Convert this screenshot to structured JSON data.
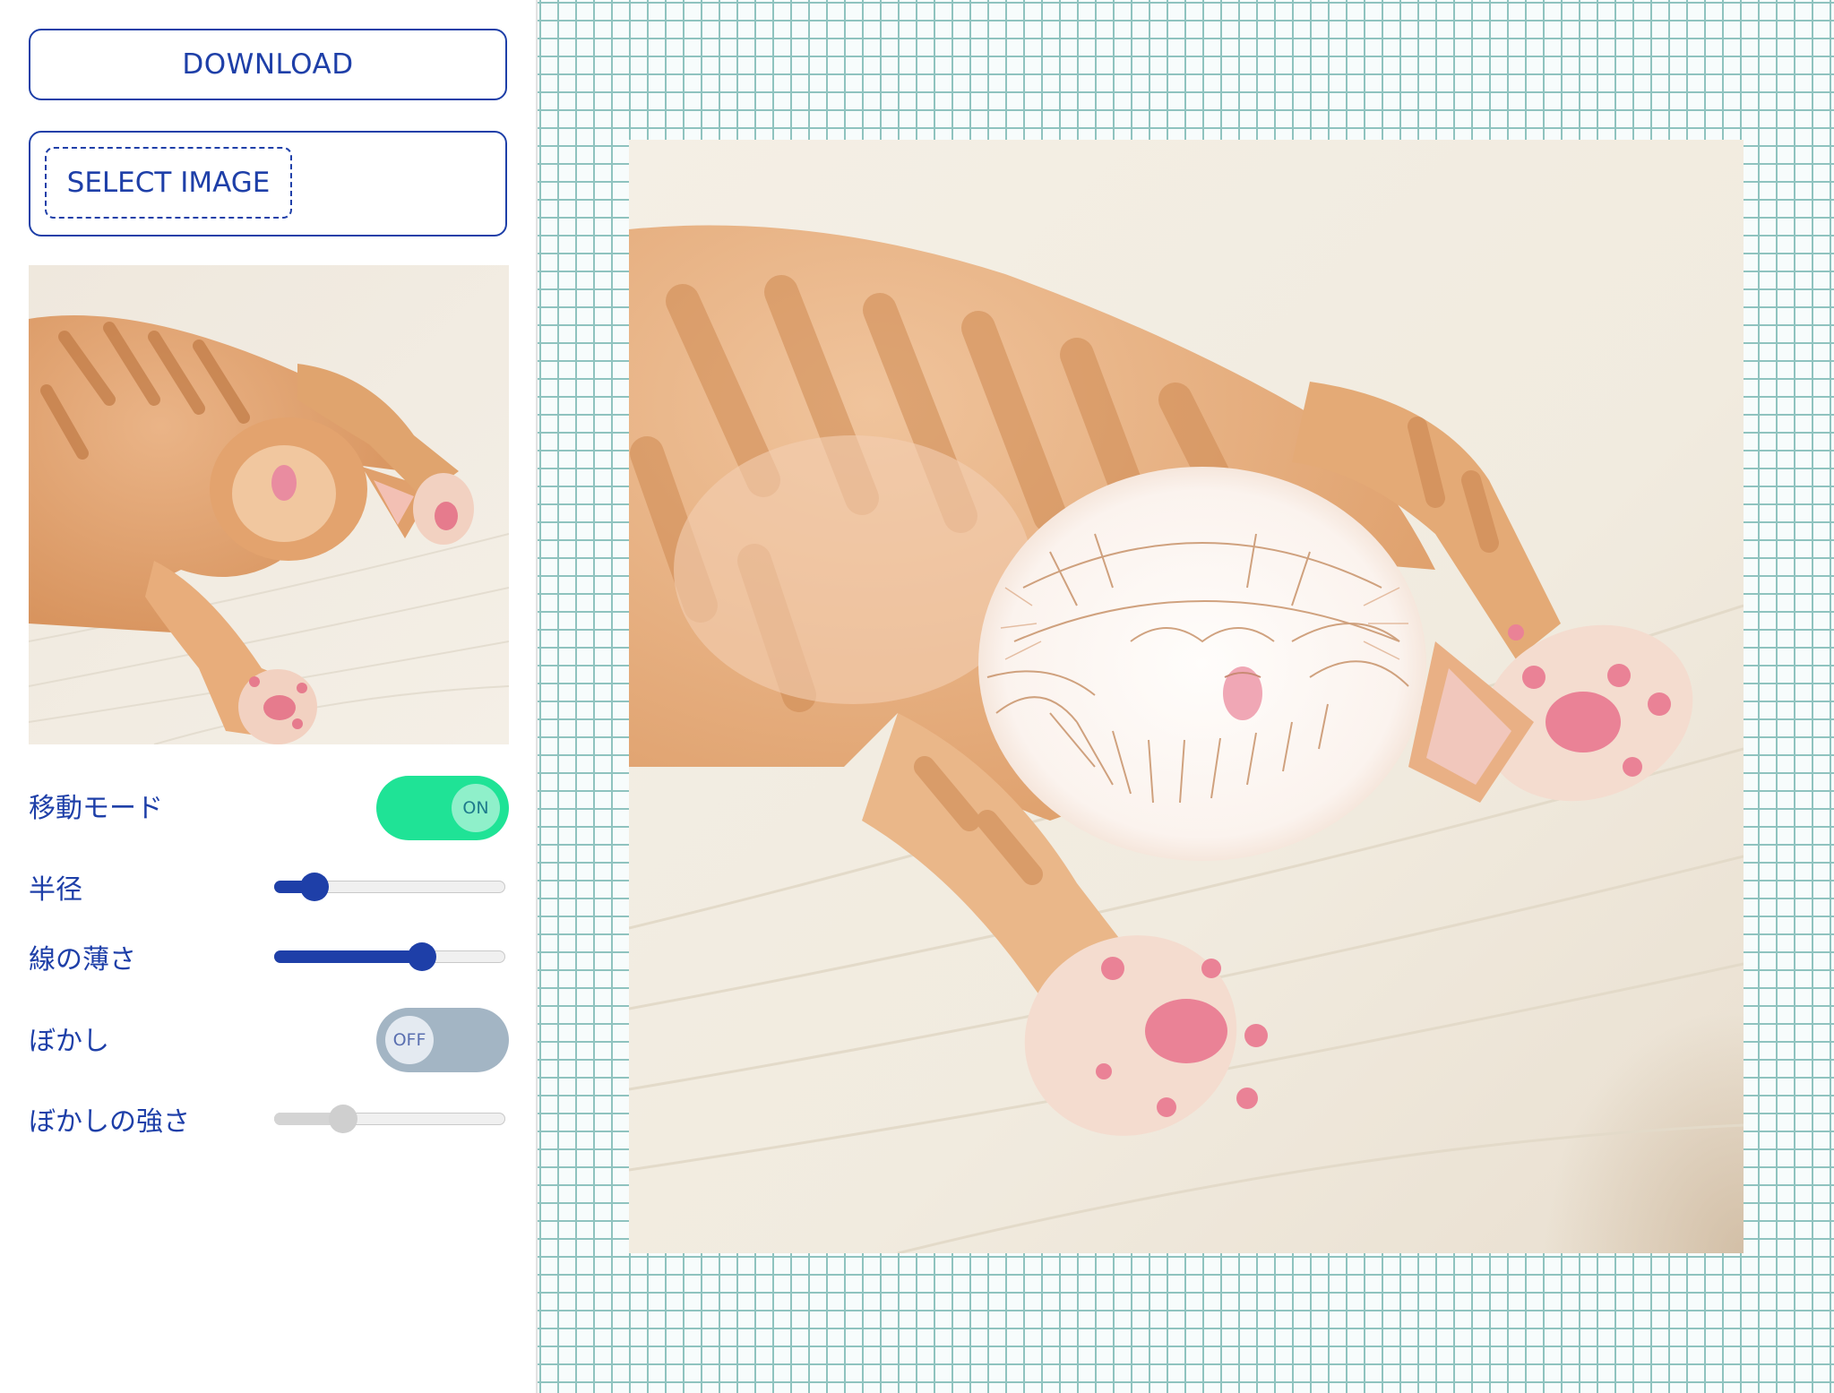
{
  "toolbar": {
    "download_label": "DOWNLOAD",
    "select_image_label": "SELECT IMAGE"
  },
  "controls": {
    "move_mode": {
      "label": "移動モード",
      "state_text": "ON",
      "on": true
    },
    "radius": {
      "label": "半径",
      "value_fraction": 0.13,
      "enabled": true
    },
    "line_thinness": {
      "label": "線の薄さ",
      "value_fraction": 0.66,
      "enabled": true
    },
    "blur": {
      "label": "ぼかし",
      "state_text": "OFF",
      "on": false
    },
    "blur_strength": {
      "label": "ぼかしの強さ",
      "value_fraction": 0.27,
      "enabled": false
    }
  },
  "images": {
    "thumbnail": "sleeping-kitten-photo",
    "canvas": "sleeping-kitten-photo-with-sketch-effect-on-face"
  },
  "colors": {
    "accent": "#1e3fa8",
    "toggle_on": "#1fe396",
    "toggle_off": "#a3b5c4",
    "grid_line": "#8fc3bf"
  }
}
